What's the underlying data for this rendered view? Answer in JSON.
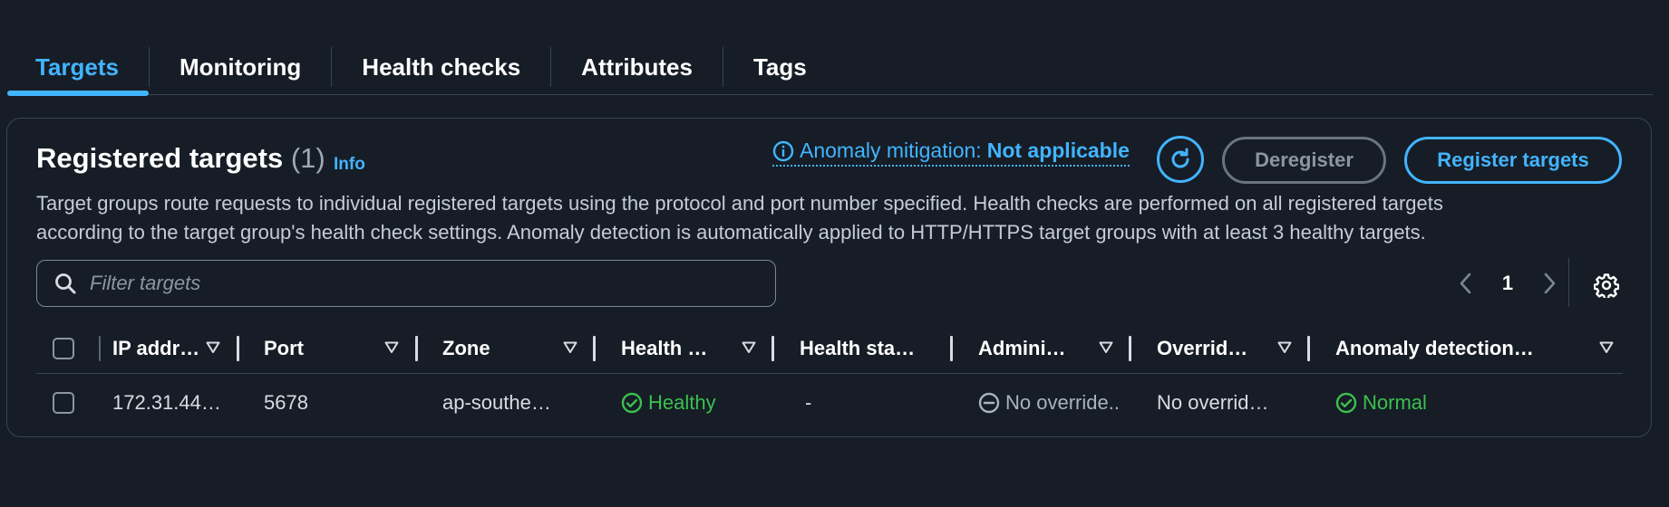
{
  "tabs": [
    {
      "label": "Targets",
      "active": true
    },
    {
      "label": "Monitoring",
      "active": false
    },
    {
      "label": "Health checks",
      "active": false
    },
    {
      "label": "Attributes",
      "active": false
    },
    {
      "label": "Tags",
      "active": false
    }
  ],
  "panel": {
    "title": "Registered targets",
    "count": "(1)",
    "info_label": "Info",
    "anomaly_label": "Anomaly mitigation:",
    "anomaly_value": "Not applicable",
    "deregister_label": "Deregister",
    "register_label": "Register targets",
    "description_line1": "Target groups route requests to individual registered targets using the protocol and port number specified. Health checks are performed on all registered targets",
    "description_line2": "according to the target group's health check settings. Anomaly detection is automatically applied to HTTP/HTTPS target groups with at least 3 healthy targets."
  },
  "filter": {
    "placeholder": "Filter targets",
    "value": ""
  },
  "pagination": {
    "current_page": "1"
  },
  "table": {
    "headers": [
      "IP addr…",
      "Port",
      "Zone",
      "Health …",
      "Health sta…",
      "Admini…",
      "Overrid…",
      "Anomaly detection…"
    ],
    "rows": [
      {
        "ip": "172.31.44…",
        "port": "5678",
        "zone": "ap-southe…",
        "health_status": "Healthy",
        "health_status_details": "-",
        "admin_override": "No override..",
        "override_details": "No overrid…",
        "anomaly_detection": "Normal"
      }
    ]
  },
  "colors": {
    "background": "#161d26",
    "accent": "#42b4ff",
    "success": "#3cc04f",
    "border": "#3a4452",
    "muted": "#8c95a1"
  },
  "icons": [
    "info-circle-icon",
    "refresh-icon",
    "search-icon",
    "chevron-left-icon",
    "chevron-right-icon",
    "gear-icon",
    "sort-caret-icon",
    "check-circle-icon",
    "minus-circle-icon"
  ]
}
